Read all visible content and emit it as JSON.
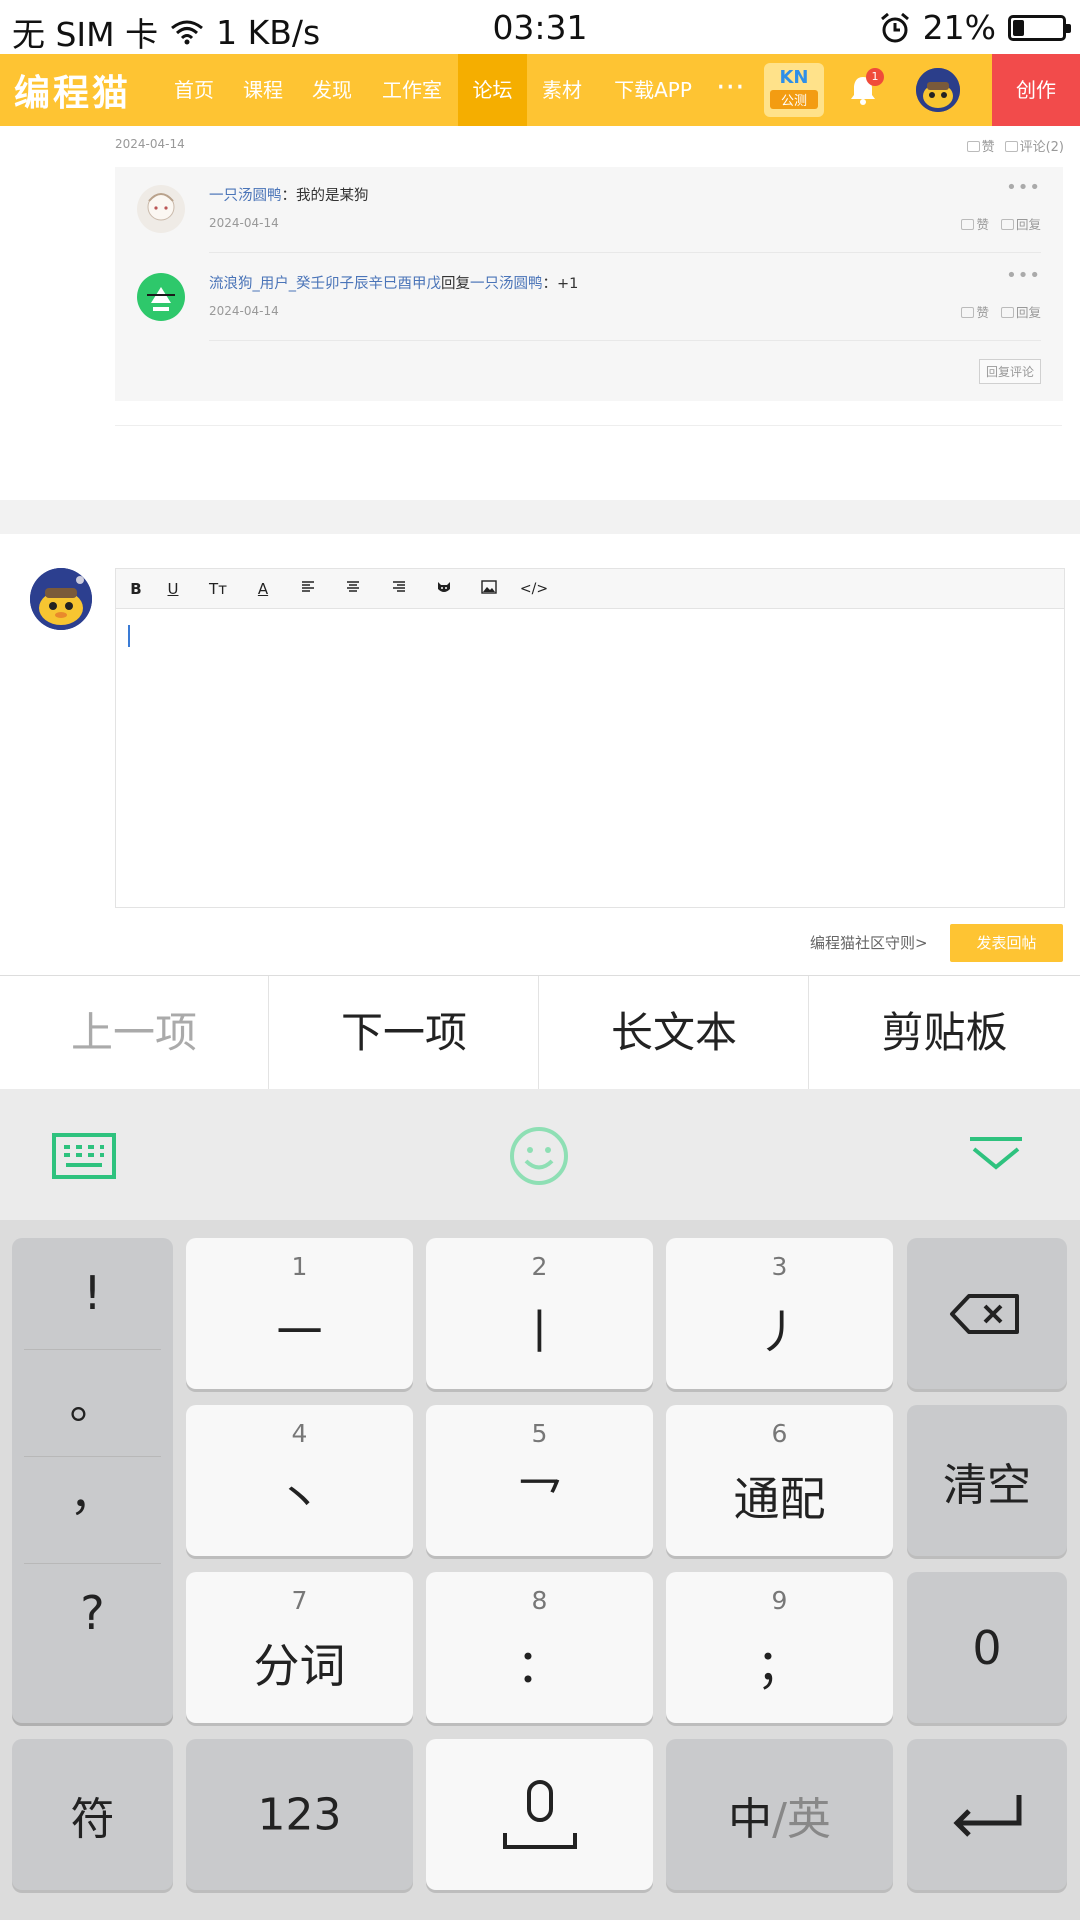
{
  "status_bar": {
    "carrier": "无 SIM 卡",
    "speed": "1 KB/s",
    "time": "03:31",
    "battery": "21%",
    "battery_level": 0.21
  },
  "nav": {
    "logo": "编程猫",
    "items": [
      "首页",
      "课程",
      "发现",
      "工作室",
      "论坛",
      "素材",
      "下载APP"
    ],
    "active": "论坛",
    "more": "···",
    "kn_label": "KN",
    "kn_sub": "公测",
    "notification_count": "1",
    "create": "创作",
    "colors": {
      "bar": "#fec433",
      "active": "#f5ae00",
      "create": "#f24b4b"
    }
  },
  "comment": {
    "date": "2024-04-14",
    "like": "赞",
    "comments": "评论(2)",
    "replies": [
      {
        "user": "一只汤圆鸭",
        "separator": "：",
        "text": "我的是某狗",
        "date": "2024-04-14",
        "like": "赞",
        "reply": "回复"
      },
      {
        "user": "流浪狗_用户_癸壬卯子辰辛巳酉甲戊",
        "mid": "回复",
        "target": "一只汤圆鸭",
        "separator": "：",
        "text": "+1",
        "date": "2024-04-14",
        "like": "赞",
        "reply": "回复"
      }
    ],
    "reply_comment_button": "回复评论"
  },
  "editor": {
    "toolbar": [
      "B",
      "U",
      "Tт",
      "A",
      "≡",
      "≡",
      "≡",
      "cat",
      "image",
      "</>"
    ],
    "guidelines": "编程猫社区守则>",
    "submit": "发表回帖"
  },
  "accessory_bar": {
    "prev": "上一项",
    "next": "下一项",
    "long_text": "长文本",
    "clipboard": "剪贴板"
  },
  "keyboard": {
    "toolbar_icons": [
      "keyboard-icon",
      "emoji-icon",
      "collapse-icon"
    ],
    "symbols": [
      "!",
      "。",
      "，",
      "?"
    ],
    "keys": [
      {
        "num": "1",
        "label": "一"
      },
      {
        "num": "2",
        "label": "丨"
      },
      {
        "num": "3",
        "label": "丿"
      },
      {
        "num": "4",
        "label": "丶"
      },
      {
        "num": "5",
        "label": "乛"
      },
      {
        "num": "6",
        "label": "通配"
      },
      {
        "num": "7",
        "label": "分词"
      },
      {
        "num": "8",
        "label": "："
      },
      {
        "num": "9",
        "label": "；"
      }
    ],
    "clear": "清空",
    "zero": "0",
    "fu": "符",
    "num123": "123",
    "lang_cn": "中",
    "lang_sep": "/",
    "lang_en": "英"
  }
}
